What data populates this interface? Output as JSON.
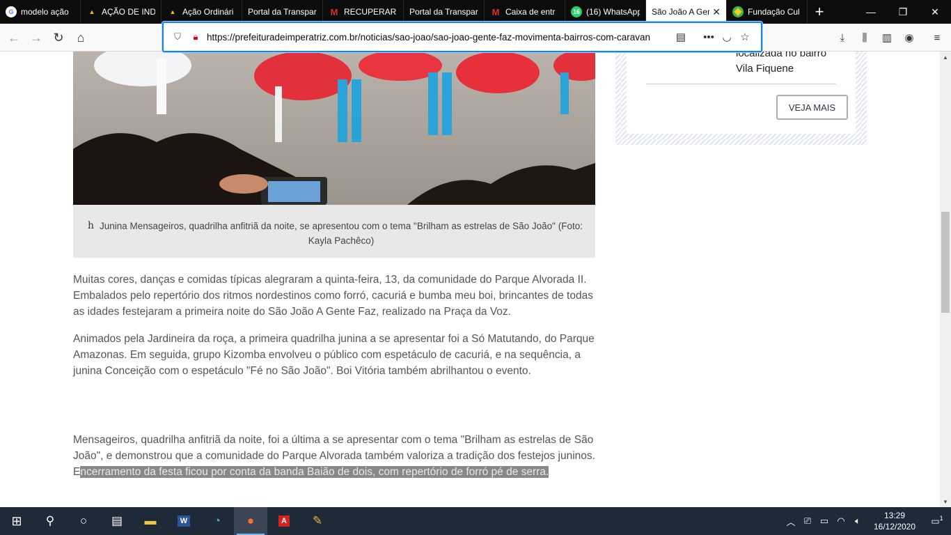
{
  "browser": {
    "tabs": [
      {
        "title": "modelo ação",
        "icon": "google-icon",
        "icon_color": "#4285f4"
      },
      {
        "title": "AÇÃO DE IND",
        "icon": "drive-icon",
        "icon_color": "#fbbc04"
      },
      {
        "title": "Ação Ordinári",
        "icon": "drive-icon",
        "icon_color": "#fbbc04"
      },
      {
        "title": "Portal da Transpar",
        "icon": "",
        "icon_color": ""
      },
      {
        "title": "RECUPERAR S",
        "icon": "gmail-icon",
        "icon_color": "#d93025"
      },
      {
        "title": "Portal da Transpar",
        "icon": "",
        "icon_color": ""
      },
      {
        "title": "Caixa de entr",
        "icon": "gmail-icon",
        "icon_color": "#d93025"
      },
      {
        "title": "(16) WhatsApp",
        "icon": "whatsapp-icon",
        "icon_color": "#25d366",
        "badge": "16"
      },
      {
        "title": "São João A Gente",
        "icon": "",
        "icon_color": "",
        "active": true
      },
      {
        "title": "Fundação Cul",
        "icon": "brazil-flag-icon",
        "icon_color": "#f7d117"
      }
    ],
    "url": "https://prefeituradeimperatriz.com.br/noticias/sao-joao/sao-joao-gente-faz-movimenta-bairros-com-caravan"
  },
  "article": {
    "caption_mark": "h",
    "caption": "Junina Mensageiros, quadrilha anfitriã da noite, se apresentou com o tema \"Brilham as estrelas de São João\" (Foto: Kayla Pachêco)",
    "paragraphs": [
      "Muitas cores, danças e comidas típicas alegraram a quinta-feira, 13, da comunidade do Parque Alvorada II. Embalados pelo repertório dos ritmos nordestinos como forró, cacuriá e bumba meu boi, brincantes de todas as idades festejaram a primeira noite do São João A Gente Faz, realizado na Praça da Voz.",
      "Animados pela Jardineira da roça, a primeira quadrilha junina a se apresentar foi a Só Matutando, do Parque Amazonas. Em seguida, grupo Kizomba envolveu o público com espetáculo de cacuriá, e na sequência, a junina Conceição com o espetáculo \"Fé no São João\". Boi Vitória também abrilhantou o evento."
    ],
    "last_paragraph": "Mensageiros, quadrilha anfitriã da noite, foi a última a se apresentar com o tema \"Brilham as estrelas de São João\", e demonstrou que a comunidade do Parque Alvorada também valoriza a tradição dos festejos juninos. E",
    "last_paragraph_highlight": "ncerramento da festa ficou por conta da banda Baião de dois, com repertório de forró pé de serra. "
  },
  "sidebar": {
    "text_line1": "localizada no bairro",
    "text_line2": "Vila Fiquene",
    "button": "VEJA MAIS"
  },
  "taskbar": {
    "time": "13:29",
    "date": "16/12/2020",
    "notifications": "1"
  }
}
